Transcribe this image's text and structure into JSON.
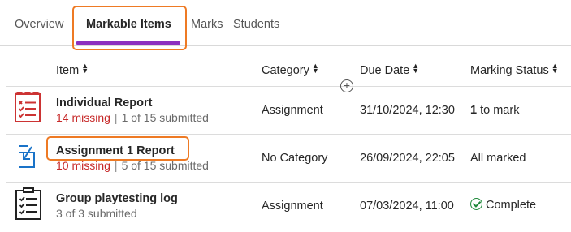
{
  "tabs": [
    {
      "label": "Overview",
      "active": false
    },
    {
      "label": "Markable Items",
      "active": true
    },
    {
      "label": "Marks",
      "active": false
    },
    {
      "label": "Students",
      "active": false
    }
  ],
  "table": {
    "columns": [
      "Item",
      "Category",
      "Due Date",
      "Marking Status"
    ],
    "rows": [
      {
        "title": "Individual Report",
        "missing": "14 missing",
        "submitted": "1 of 15 submitted",
        "category": "Assignment",
        "due": "31/10/2024, 12:30",
        "status_count": "1",
        "status_text": "to mark",
        "icon": "red-checklist-document-icon"
      },
      {
        "title": "Assignment 1 Report",
        "missing": "10 missing",
        "submitted": "5 of 15 submitted",
        "category": "No Category",
        "due": "26/09/2024, 22:05",
        "status_text": "All marked",
        "icon": "blue-submission-arrow-icon"
      },
      {
        "title": "Group playtesting log",
        "submitted": "3 of 3 submitted",
        "category": "Assignment",
        "due": "07/03/2024, 11:00",
        "status_text": "Complete",
        "icon": "black-checklist-document-icon"
      }
    ]
  },
  "colors": {
    "accent": "#8c2fbf",
    "highlight": "#ee7a24",
    "missing": "#c62828",
    "complete": "#1f8a3b",
    "link_blue": "#1a73c8"
  }
}
